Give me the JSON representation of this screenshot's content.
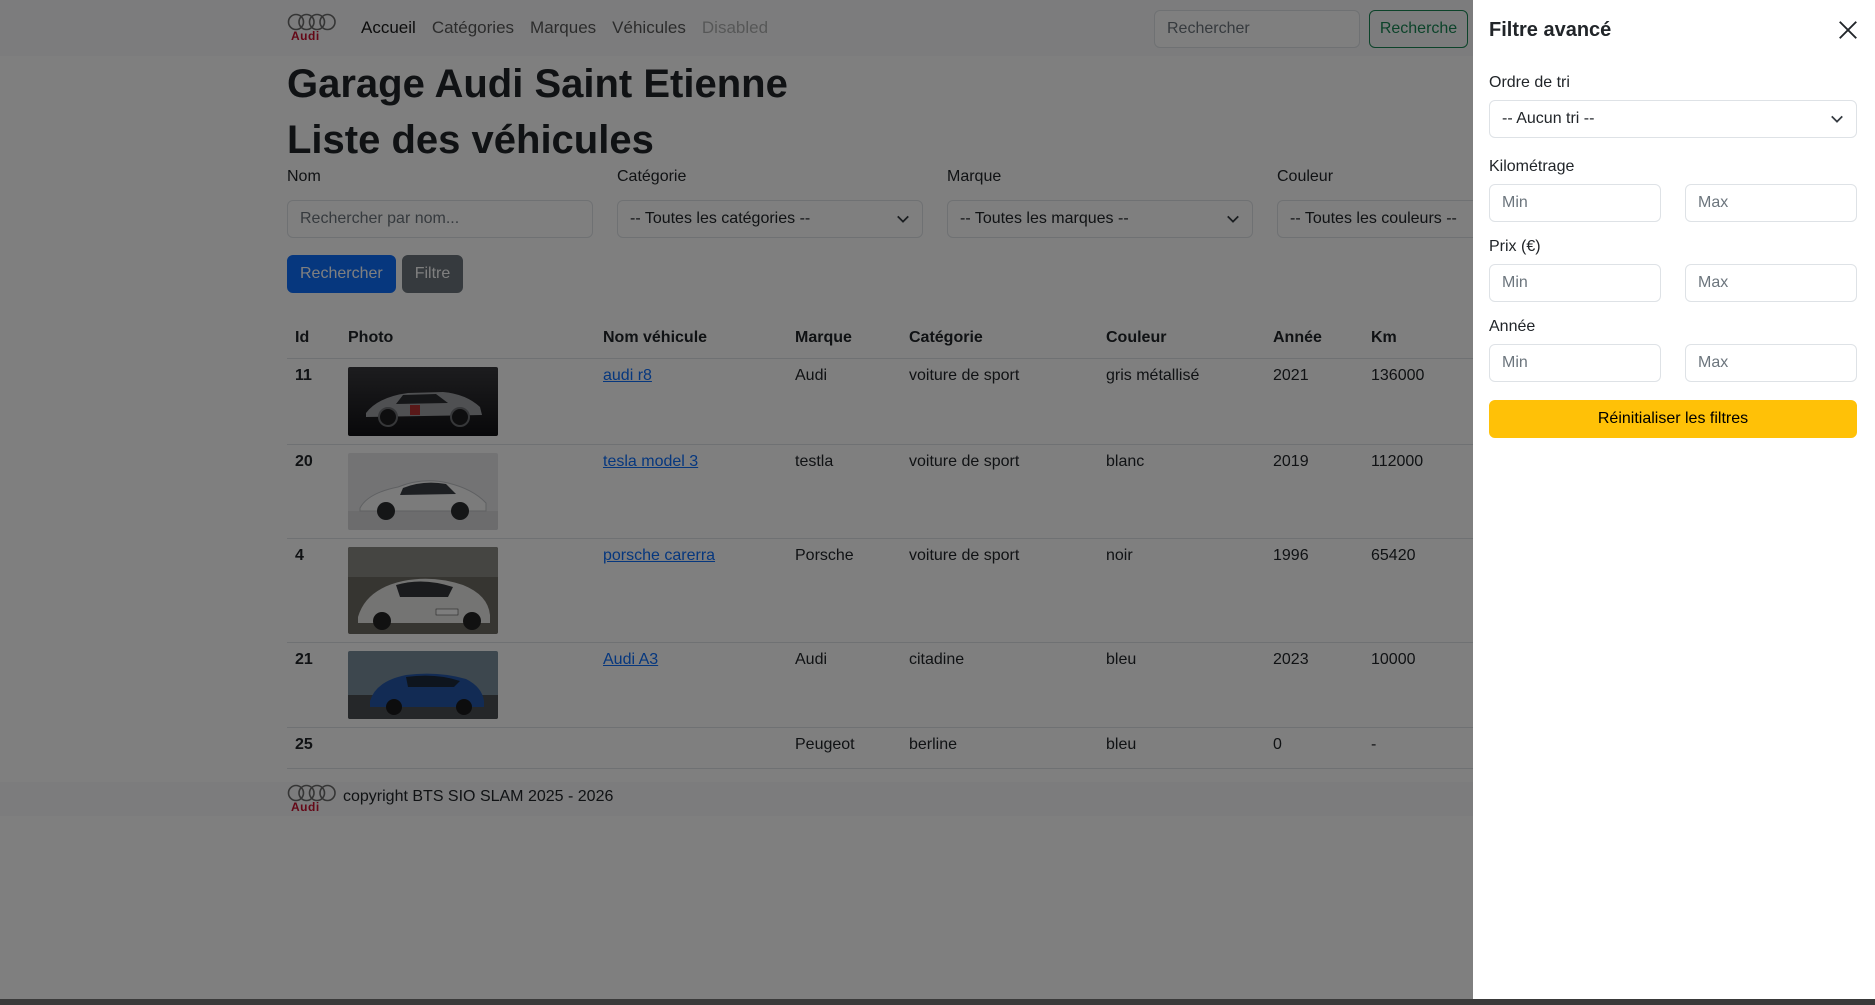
{
  "nav": {
    "brand": "Audi",
    "links": [
      {
        "label": "Accueil",
        "state": "active"
      },
      {
        "label": "Catégories",
        "state": "normal"
      },
      {
        "label": "Marques",
        "state": "normal"
      },
      {
        "label": "Véhicules",
        "state": "normal"
      },
      {
        "label": "Disabled",
        "state": "disabled"
      }
    ],
    "search_placeholder": "Rechercher",
    "search_button": "Recherche"
  },
  "main": {
    "title": "Garage Audi Saint Etienne",
    "subtitle": "Liste des véhicules",
    "filters": {
      "name_label": "Nom",
      "name_placeholder": "Rechercher par nom...",
      "category_label": "Catégorie",
      "category_value": "-- Toutes les catégories --",
      "brand_label": "Marque",
      "brand_value": "-- Toutes les marques --",
      "color_label": "Couleur",
      "color_value": "-- Toutes les couleurs --"
    },
    "search_button": "Rechercher",
    "filter_button": "Filtre",
    "table": {
      "headers": [
        "Id",
        "Photo",
        "Nom véhicule",
        "Marque",
        "Catégorie",
        "Couleur",
        "Année",
        "Km"
      ],
      "rows": [
        {
          "id": "11",
          "photo": "silver-sports-car",
          "name": "audi r8",
          "brand": "Audi",
          "category": "voiture de sport",
          "color": "gris métallisé",
          "year": "2021",
          "km": "136000"
        },
        {
          "id": "20",
          "photo": "white-sedan",
          "name": "tesla model 3",
          "brand": "testla",
          "category": "voiture de sport",
          "color": "blanc",
          "year": "2019",
          "km": "112000"
        },
        {
          "id": "4",
          "photo": "white-porsche",
          "name": "porsche carerra",
          "brand": "Porsche",
          "category": "voiture de sport",
          "color": "noir",
          "year": "1996",
          "km": "65420"
        },
        {
          "id": "21",
          "photo": "blue-hatchback",
          "name": "Audi A3",
          "brand": "Audi",
          "category": "citadine",
          "color": "bleu",
          "year": "2023",
          "km": "10000"
        },
        {
          "id": "25",
          "photo": "",
          "name": "",
          "brand": "Peugeot",
          "category": "berline",
          "color": "bleu",
          "year": "0",
          "km": "-"
        }
      ]
    }
  },
  "footer": {
    "brand": "Audi",
    "copyright": "copyright BTS SIO SLAM 2025 - 2026"
  },
  "offcanvas": {
    "title": "Filtre avancé",
    "sort_label": "Ordre de tri",
    "sort_value": "-- Aucun tri --",
    "km_label": "Kilométrage",
    "price_label": "Prix (€)",
    "year_label": "Année",
    "min_placeholder": "Min",
    "max_placeholder": "Max",
    "reset_button": "Réinitialiser les filtres"
  },
  "colors": {
    "primary": "#0d6efd",
    "secondary": "#6c757d",
    "success": "#198754",
    "warning": "#ffc107",
    "logo_red": "#c8102e"
  },
  "icons": {
    "sort_select": "chevron-down-icon",
    "close": "close-icon"
  }
}
